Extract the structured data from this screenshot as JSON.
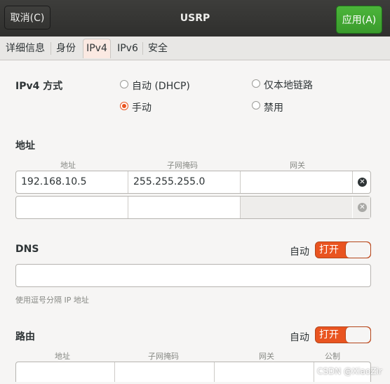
{
  "window": {
    "cancel_label": "取消(C)",
    "title": "USRP",
    "apply_label": "应用(A)"
  },
  "tabs": [
    "详细信息",
    "身份",
    "IPv4",
    "IPv6",
    "安全"
  ],
  "ipv4_method": {
    "label": "IPv4 方式",
    "options": [
      "自动 (DHCP)",
      "仅本地链路",
      "手动",
      "禁用"
    ],
    "selected": "手动"
  },
  "addresses": {
    "section_title": "地址",
    "columns": [
      "地址",
      "子网掩码",
      "网关"
    ],
    "rows": [
      [
        "192.168.10.5",
        "255.255.255.0",
        ""
      ],
      [
        "",
        "",
        ""
      ]
    ]
  },
  "dns": {
    "label": "DNS",
    "auto_label": "自动",
    "toggle_label": "打开",
    "value": "",
    "hint": "使用逗号分隔 IP 地址"
  },
  "routes": {
    "label": "路由",
    "auto_label": "自动",
    "toggle_label": "打开",
    "columns": [
      "地址",
      "子网掩码",
      "网关",
      "公制"
    ]
  },
  "watermark": "CSDN @XiaoZir",
  "colors": {
    "accent": "#e95420",
    "apply_button": "#3f9e30",
    "titlebar": "#353533"
  }
}
